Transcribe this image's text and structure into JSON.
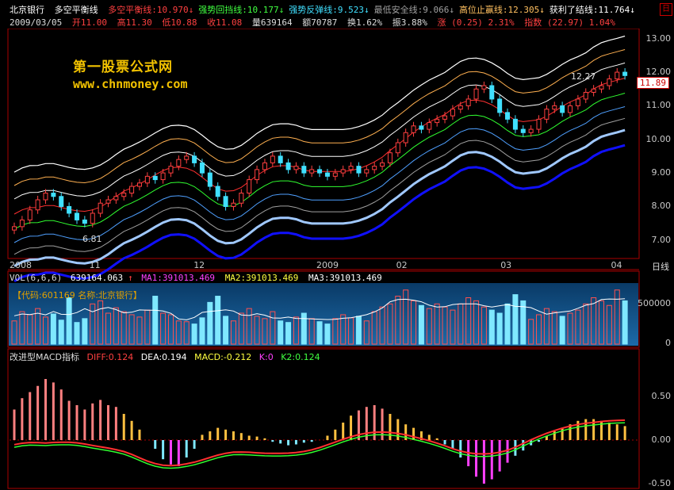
{
  "colors": {
    "up": "#ff4040",
    "down": "#40e0ff",
    "bg": "#000000",
    "accent": "#f2c200",
    "grid": "#aa0000"
  },
  "header": {
    "stock_name": "北京银行",
    "indicator_name": "多空平衡线",
    "lines": [
      {
        "label": "多空平衡线:10.970",
        "arrow": "↓",
        "color": "#ff4040"
      },
      {
        "label": "强势回挡线:10.177",
        "arrow": "↓",
        "color": "#40ff40"
      },
      {
        "label": "强势反弹线:9.523",
        "arrow": "↓",
        "color": "#40e0ff"
      },
      {
        "label": "最低安全线:9.066",
        "arrow": "↓",
        "color": "#a0a0a0"
      },
      {
        "label": "高位止赢线:12.305",
        "arrow": "↓",
        "color": "#ffc060"
      },
      {
        "label": "获利了结线:11.764",
        "arrow": "↓",
        "color": "#ffffff"
      }
    ]
  },
  "quote": {
    "date": "2009/03/05",
    "open": "开11.00",
    "high": "高11.30",
    "low": "低10.88",
    "close": "收11.08",
    "volume": "量639164",
    "amount": "额70787",
    "turnover": "换1.62%",
    "amplitude": "振3.88%",
    "change": "涨 (0.25) 2.31%",
    "index": "指数 (22.97) 1.04%"
  },
  "watermark": {
    "title": "第一股票公式网",
    "url": "www.chnmoney.com"
  },
  "price_axis": [
    "13.00",
    "12.00",
    "11.00",
    "10.00",
    "9.00",
    "8.00",
    "7.00"
  ],
  "current_price": "11.89",
  "high_label": "12.27",
  "low_label": "6.81",
  "date_axis": [
    "2008",
    "11",
    "12",
    "2009",
    "02",
    "03",
    "04"
  ],
  "period": "日线",
  "volume_panel": {
    "title": "VOL(6,6,6)",
    "value": "639164.063",
    "ma1": "MA1:391013.469",
    "ma2": "MA2:391013.469",
    "ma3": "MA3:391013.469",
    "code_line": "【代码:601169 名称:北京银行】",
    "axis": [
      "500000",
      "0"
    ]
  },
  "macd_panel": {
    "title": "改进型MACD指标",
    "diff": "DIFF:0.124",
    "dea": "DEA:0.194",
    "macd": "MACD:-0.212",
    "k": "K:0",
    "k2": "K2:0.124",
    "axis": [
      "0.50",
      "0.00",
      "-0.50"
    ]
  },
  "chart_data": {
    "type": "candlestick",
    "title": "北京银行 多空平衡线",
    "x_range": [
      "2008",
      "2009/03"
    ],
    "ylim": [
      6.5,
      13.3
    ],
    "close": [
      7.4,
      7.6,
      7.9,
      8.2,
      8.4,
      8.3,
      8.0,
      7.8,
      7.6,
      7.5,
      7.8,
      8.1,
      8.2,
      8.3,
      8.4,
      8.6,
      8.7,
      8.9,
      8.8,
      9.0,
      9.2,
      9.4,
      9.5,
      9.3,
      9.0,
      8.6,
      8.3,
      8.0,
      8.1,
      8.4,
      8.8,
      9.1,
      9.3,
      9.5,
      9.3,
      9.1,
      9.2,
      9.0,
      9.1,
      9.0,
      8.9,
      9.0,
      9.1,
      9.2,
      9.0,
      9.1,
      9.2,
      9.3,
      9.6,
      9.9,
      10.2,
      10.4,
      10.3,
      10.5,
      10.6,
      10.7,
      10.9,
      11.0,
      11.2,
      11.5,
      11.6,
      11.2,
      10.8,
      10.6,
      10.3,
      10.2,
      10.3,
      10.6,
      10.9,
      11.0,
      10.8,
      11.0,
      11.2,
      11.4,
      11.5,
      11.6,
      11.8,
      12.0,
      11.9
    ],
    "volume_k": [
      300,
      420,
      380,
      460,
      350,
      390,
      310,
      600,
      280,
      330,
      520,
      560,
      400,
      470,
      420,
      380,
      350,
      440,
      620,
      400,
      380,
      300,
      290,
      260,
      340,
      540,
      620,
      360,
      300,
      400,
      460,
      360,
      330,
      420,
      300,
      280,
      350,
      400,
      330,
      290,
      260,
      330,
      380,
      340,
      360,
      300,
      420,
      480,
      520,
      620,
      700,
      560,
      500,
      460,
      520,
      480,
      440,
      520,
      600,
      560,
      480,
      440,
      400,
      520,
      640,
      560,
      320,
      380,
      460,
      420,
      360,
      400,
      440,
      520,
      600,
      560,
      500,
      700,
      560
    ],
    "macd_hist": [
      0.35,
      0.48,
      0.55,
      0.62,
      0.7,
      0.66,
      0.58,
      0.45,
      0.4,
      0.35,
      0.42,
      0.46,
      0.4,
      0.38,
      0.3,
      0.22,
      0.12,
      0.0,
      -0.1,
      -0.22,
      -0.28,
      -0.3,
      -0.2,
      -0.1,
      0.06,
      0.1,
      0.14,
      0.12,
      0.1,
      0.08,
      0.05,
      0.04,
      0.02,
      -0.02,
      -0.04,
      -0.06,
      -0.05,
      -0.03,
      -0.02,
      0.0,
      0.05,
      0.12,
      0.2,
      0.28,
      0.34,
      0.38,
      0.4,
      0.36,
      0.3,
      0.24,
      0.18,
      0.14,
      0.1,
      0.06,
      0.02,
      -0.05,
      -0.1,
      -0.2,
      -0.3,
      -0.42,
      -0.5,
      -0.45,
      -0.36,
      -0.26,
      -0.18,
      -0.12,
      -0.06,
      -0.02,
      0.05,
      0.1,
      0.14,
      0.18,
      0.22,
      0.24,
      0.24,
      0.22,
      0.2,
      0.18,
      0.16
    ]
  }
}
